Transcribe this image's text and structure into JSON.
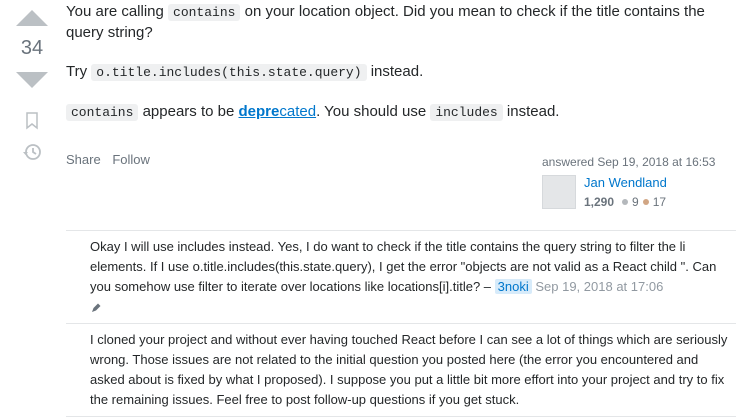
{
  "vote": {
    "count": "34"
  },
  "post": {
    "p1_before": "You are calling ",
    "p1_code": "contains",
    "p1_after": " on your location object. Did you mean to check if the title contains the query string?",
    "p2_before": "Try ",
    "p2_code": "o.title.includes(this.state.query)",
    "p2_after": " instead.",
    "p3_code": "contains",
    "p3_middle": " appears to be ",
    "p3_link_bold": "depre",
    "p3_link_rest": "cated",
    "p3_middle2": ". You should use ",
    "p3_code2": "includes",
    "p3_after": " instead."
  },
  "menu": {
    "share": "Share",
    "follow": "Follow"
  },
  "signature": {
    "action": "answered ",
    "date": "Sep 19, 2018 at 16:53",
    "user": "Jan Wendland",
    "reputation": "1,290",
    "silver": "9",
    "bronze": "17",
    "silver_color": "#b4b8bc",
    "bronze_color": "#d1a684"
  },
  "comments": [
    {
      "text": "Okay I will use includes instead. Yes, I do want to check if the title contains the query string to filter the li elements. If I use o.title.includes(this.state.query), I get the error \"objects are not valid as a React child \". Can you somehow use filter to iterate over locations like locations[i].title? – ",
      "user": "3noki",
      "date": "Sep 19, 2018 at 17:06"
    },
    {
      "text": "I cloned your project and without ever having touched React before I can see a lot of things which are seriously wrong. Those issues are not related to the initial question you posted here (the error you encountered and asked about is fixed by what I proposed). I suppose you put a little bit more effort into your project and try to fix the remaining issues. Feel free to post follow-up questions if you get stuck."
    }
  ]
}
